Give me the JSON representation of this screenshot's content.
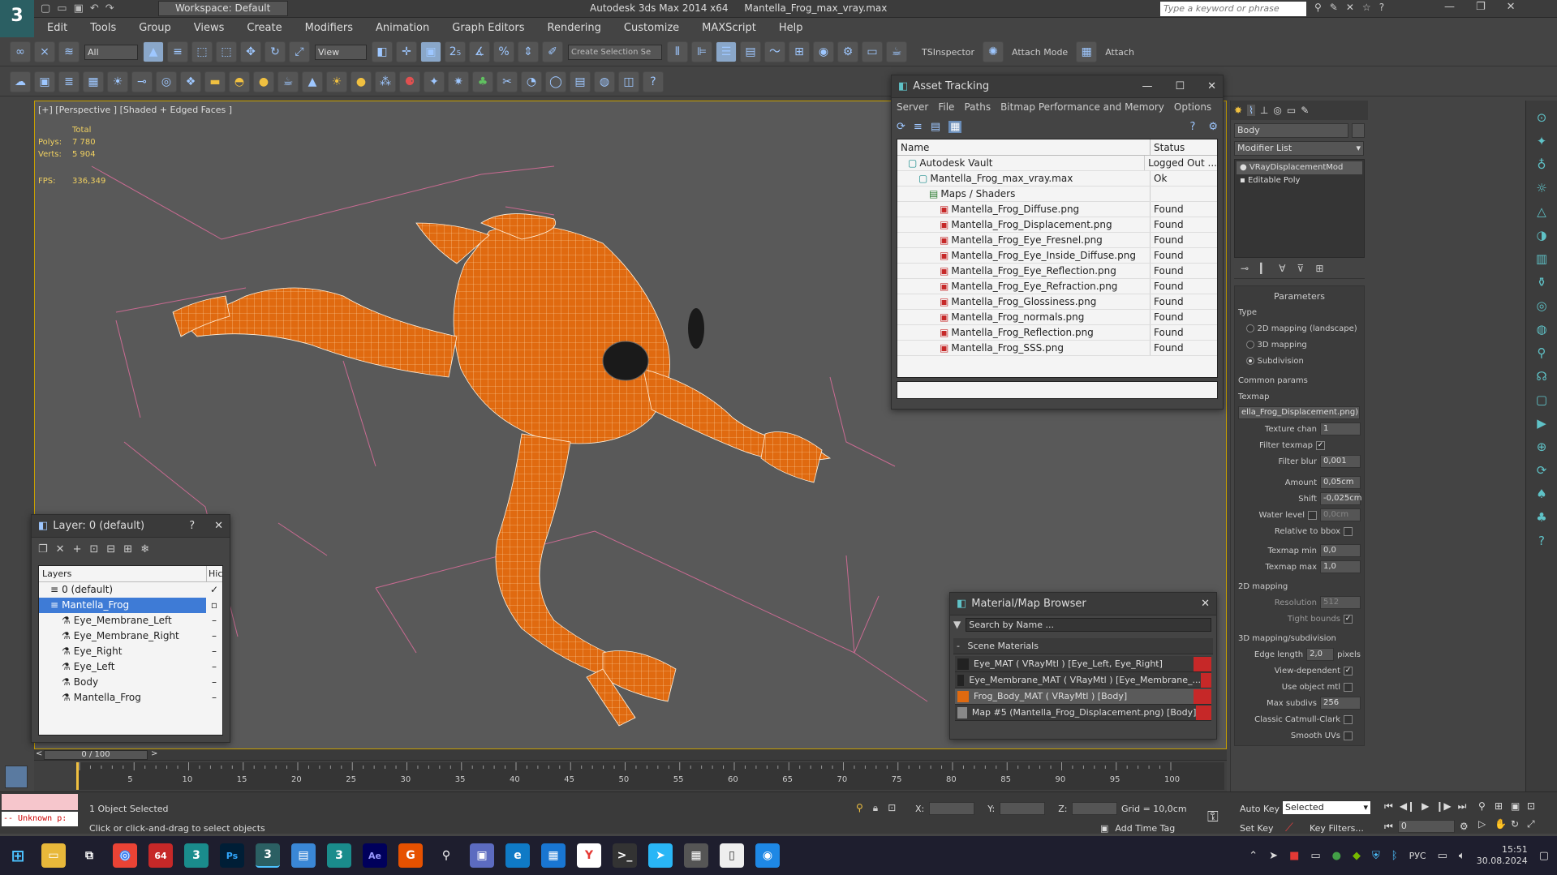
{
  "app": {
    "workspace": "Workspace: Default",
    "title": "Autodesk 3ds Max  2014 x64",
    "file": "Mantella_Frog_max_vray.max",
    "search_placeholder": "Type a keyword or phrase"
  },
  "menu": [
    "Edit",
    "Tools",
    "Group",
    "Views",
    "Create",
    "Modifiers",
    "Animation",
    "Graph Editors",
    "Rendering",
    "Customize",
    "MAXScript",
    "Help"
  ],
  "toolbar": {
    "filter": "All",
    "ref_coord": "View",
    "selection_set": "Create Selection Se",
    "tsinspector": "TSInspector",
    "attach_mode": "Attach Mode",
    "attach": "Attach"
  },
  "viewport": {
    "label": "[+] [Perspective ] [Shaded + Edged Faces ]",
    "stats": {
      "total_label": "Total",
      "polys_label": "Polys:",
      "polys": "7 780",
      "verts_label": "Verts:",
      "verts": "5 904",
      "fps_label": "FPS:",
      "fps": "336,349"
    }
  },
  "asset_tracking": {
    "title": "Asset Tracking",
    "menu": [
      "Server",
      "File",
      "Paths",
      "Bitmap Performance and Memory",
      "Options"
    ],
    "col_name": "Name",
    "col_status": "Status",
    "rows": [
      {
        "name": "Autodesk Vault",
        "status": "Logged Out ...",
        "indent": 1
      },
      {
        "name": "Mantella_Frog_max_vray.max",
        "status": "Ok",
        "indent": 2
      },
      {
        "name": "Maps / Shaders",
        "status": "",
        "indent": 3
      },
      {
        "name": "Mantella_Frog_Diffuse.png",
        "status": "Found",
        "indent": 4
      },
      {
        "name": "Mantella_Frog_Displacement.png",
        "status": "Found",
        "indent": 4
      },
      {
        "name": "Mantella_Frog_Eye_Fresnel.png",
        "status": "Found",
        "indent": 4
      },
      {
        "name": "Mantella_Frog_Eye_Inside_Diffuse.png",
        "status": "Found",
        "indent": 4
      },
      {
        "name": "Mantella_Frog_Eye_Reflection.png",
        "status": "Found",
        "indent": 4
      },
      {
        "name": "Mantella_Frog_Eye_Refraction.png",
        "status": "Found",
        "indent": 4
      },
      {
        "name": "Mantella_Frog_Glossiness.png",
        "status": "Found",
        "indent": 4
      },
      {
        "name": "Mantella_Frog_normals.png",
        "status": "Found",
        "indent": 4
      },
      {
        "name": "Mantella_Frog_Reflection.png",
        "status": "Found",
        "indent": 4
      },
      {
        "name": "Mantella_Frog_SSS.png",
        "status": "Found",
        "indent": 4
      }
    ]
  },
  "layer_panel": {
    "title": "Layer: 0 (default)",
    "help": "?",
    "col_layers": "Layers",
    "col_hide": "Hic",
    "rows": [
      {
        "name": "0 (default)",
        "indent": 1,
        "selected": false
      },
      {
        "name": "Mantella_Frog",
        "indent": 1,
        "selected": true
      },
      {
        "name": "Eye_Membrane_Left",
        "indent": 2,
        "selected": false
      },
      {
        "name": "Eye_Membrane_Right",
        "indent": 2,
        "selected": false
      },
      {
        "name": "Eye_Right",
        "indent": 2,
        "selected": false
      },
      {
        "name": "Eye_Left",
        "indent": 2,
        "selected": false
      },
      {
        "name": "Body",
        "indent": 2,
        "selected": false
      },
      {
        "name": "Mantella_Frog",
        "indent": 2,
        "selected": false
      }
    ]
  },
  "material_browser": {
    "title": "Material/Map Browser",
    "search_placeholder": "Search by Name ...",
    "group": "Scene Materials",
    "rows": [
      "Eye_MAT ( VRayMtl ) [Eye_Left, Eye_Right]",
      "Eye_Membrane_MAT ( VRayMtl ) [Eye_Membrane_...",
      "Frog_Body_MAT ( VRayMtl ) [Body]",
      "Map #5 (Mantella_Frog_Displacement.png) [Body]"
    ]
  },
  "command_panel": {
    "object_name": "Body",
    "modifier_list": "Modifier List",
    "stack": [
      "VRayDisplacementMod",
      "Editable Poly"
    ],
    "rollout": "Parameters",
    "type_label": "Type",
    "types": [
      "2D mapping (landscape)",
      "3D mapping",
      "Subdivision"
    ],
    "type_selected": 2,
    "common_params": "Common params",
    "texmap_label": "Texmap",
    "texmap": "ella_Frog_Displacement.png)",
    "texture_chan_label": "Texture chan",
    "texture_chan": "1",
    "filter_texmap_label": "Filter texmap",
    "filter_blur_label": "Filter blur",
    "filter_blur": "0,001",
    "amount_label": "Amount",
    "amount": "0,05cm",
    "shift_label": "Shift",
    "shift": "-0,025cm",
    "water_level_label": "Water level",
    "water_level": "0,0cm",
    "relative_bbox_label": "Relative to bbox",
    "texmap_min_label": "Texmap min",
    "texmap_min": "0,0",
    "texmap_max_label": "Texmap max",
    "texmap_max": "1,0",
    "mapping2d": "2D mapping",
    "resolution_label": "Resolution",
    "resolution": "512",
    "tight_bounds_label": "Tight bounds",
    "mapping3d": "3D mapping/subdivision",
    "edge_length_label": "Edge length",
    "edge_length": "2,0",
    "pixels": "pixels",
    "view_dependent_label": "View-dependent",
    "use_object_mtl_label": "Use object mtl",
    "max_subdivs_label": "Max subdivs",
    "max_subdivs": "256",
    "classic_catmull_label": "Classic Catmull-Clark",
    "smooth_uvs_label": "Smooth UVs"
  },
  "timeline": {
    "frame": "0 / 100",
    "ticks": [
      "5",
      "10",
      "15",
      "20",
      "25",
      "30",
      "35",
      "40",
      "45",
      "50",
      "55",
      "60",
      "65",
      "70",
      "75",
      "80",
      "85",
      "90",
      "95",
      "100"
    ]
  },
  "status": {
    "script": "-- Unknown p:",
    "selected": "1 Object Selected",
    "hint": "Click or click-and-drag to select objects",
    "x_label": "X:",
    "y_label": "Y:",
    "z_label": "Z:",
    "grid": "Grid = 10,0cm",
    "add_time_tag": "Add Time Tag",
    "auto_key": "Auto Key",
    "set_key": "Set Key",
    "key_mode": "Selected",
    "key_filters": "Key Filters...",
    "frame_field": "0"
  },
  "taskbar": {
    "lang": "РУС",
    "time": "15:51",
    "date": "30.08.2024",
    "badge": "64"
  }
}
